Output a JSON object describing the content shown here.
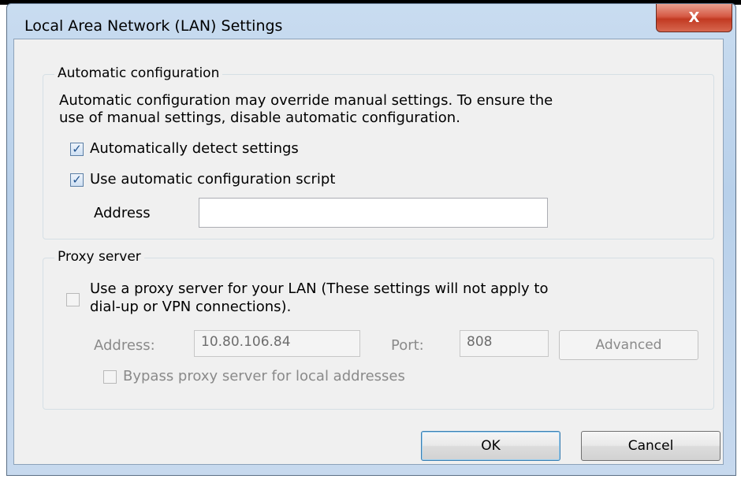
{
  "window": {
    "title": "Local Area Network (LAN) Settings",
    "close_glyph": "X"
  },
  "auto_config": {
    "legend": "Automatic configuration",
    "description_line1": "Automatic configuration may override manual settings.  To ensure the",
    "description_line2": "use of manual settings, disable automatic configuration.",
    "detect_checkbox": {
      "label": "Automatically detect settings",
      "checked": true
    },
    "script_checkbox": {
      "label": "Use automatic configuration script",
      "checked": true
    },
    "address": {
      "label": "Address",
      "value": ""
    }
  },
  "proxy": {
    "legend": "Proxy server",
    "use_proxy_checkbox": {
      "label_line1": "Use a proxy server for your LAN (These settings will not apply to",
      "label_line2": "dial-up or VPN connections).",
      "checked": false
    },
    "address_label": "Address:",
    "address_value": "10.80.106.84",
    "port_label": "Port:",
    "port_value": "808",
    "advanced_label": "Advanced",
    "bypass_checkbox": {
      "label": "Bypass proxy server for local addresses",
      "checked": false
    }
  },
  "buttons": {
    "ok": "OK",
    "cancel": "Cancel"
  }
}
